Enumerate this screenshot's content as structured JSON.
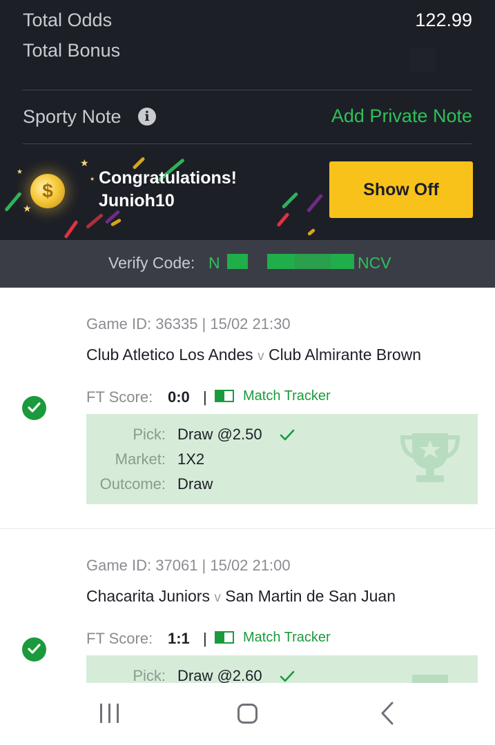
{
  "summary": {
    "total_odds_label": "Total Odds",
    "total_odds_value": "122.99",
    "total_bonus_label": "Total Bonus",
    "sporty_note_label": "Sporty Note",
    "info_icon_glyph": "i",
    "add_private_note": "Add Private Note"
  },
  "banner": {
    "coin_glyph": "$",
    "congrats_line1": "Congratulations!",
    "congrats_line2": "Junioh10",
    "show_off_button": "Show Off"
  },
  "verify": {
    "label": "Verify Code:",
    "code_start": "N",
    "code_end": "NCV"
  },
  "games": [
    {
      "game_id": "Game ID: 36335 | 15/02 21:30",
      "home": "Club Atletico Los Andes",
      "vs": "v",
      "away": "Club Almirante Brown",
      "ft_score_label": "FT Score:",
      "ft_score": "0:0",
      "separator": "|",
      "tracker": "Match Tracker",
      "pick_label": "Pick:",
      "pick_value": "Draw @2.50",
      "market_label": "Market:",
      "market_value": "1X2",
      "outcome_label": "Outcome:",
      "outcome_value": "Draw"
    },
    {
      "game_id": "Game ID: 37061 | 15/02 21:00",
      "home": "Chacarita Juniors",
      "vs": "v",
      "away": "San Martin de San Juan",
      "ft_score_label": "FT Score:",
      "ft_score": "1:1",
      "separator": "|",
      "tracker": "Match Tracker",
      "pick_label": "Pick:",
      "pick_value": "Draw @2.60"
    }
  ],
  "icons": {
    "info": "info-icon",
    "coin": "coin-icon",
    "check": "check-circle-icon",
    "tracker": "match-tracker-icon",
    "trophy": "trophy-icon",
    "nav_recent": "recent-apps-icon",
    "nav_home": "home-icon",
    "nav_back": "back-icon"
  },
  "colors": {
    "accent_green": "#2dc159",
    "show_off_yellow": "#f9c21b",
    "dark_bg": "#1d1f27",
    "pick_bg": "#d6ecd9"
  }
}
